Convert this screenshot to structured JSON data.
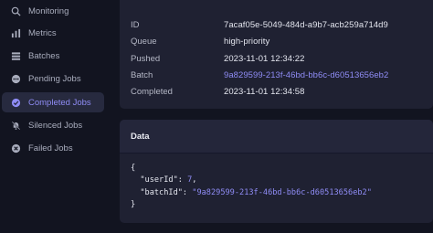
{
  "sidebar": {
    "items": [
      {
        "label": "Monitoring",
        "icon": "search-icon"
      },
      {
        "label": "Metrics",
        "icon": "bar-chart-icon"
      },
      {
        "label": "Batches",
        "icon": "stack-icon"
      },
      {
        "label": "Pending Jobs",
        "icon": "pending-icon"
      },
      {
        "label": "Completed Jobs",
        "icon": "check-circle-icon",
        "active": true
      },
      {
        "label": "Silenced Jobs",
        "icon": "bell-off-icon"
      },
      {
        "label": "Failed Jobs",
        "icon": "x-circle-icon"
      }
    ]
  },
  "details": {
    "id_label": "ID",
    "id_value": "7acaf05e-5049-484d-a9b7-acb259a714d9",
    "queue_label": "Queue",
    "queue_value": "high-priority",
    "pushed_label": "Pushed",
    "pushed_value": "2023-11-01 12:34:22",
    "batch_label": "Batch",
    "batch_value": "9a829599-213f-46bd-bb6c-d60513656eb2",
    "completed_label": "Completed",
    "completed_value": "2023-11-01 12:34:58"
  },
  "data_panel": {
    "title": "Data",
    "open_brace": "{",
    "close_brace": "}",
    "user_id_key": "\"userId\": ",
    "user_id_value": "7",
    "batch_id_key": "\"batchId\": ",
    "batch_id_value": "\"9a829599-213f-46bd-bb6c-d60513656eb2\""
  },
  "colors": {
    "background": "#121420",
    "card": "#1f2132",
    "accent": "#8f8cf5"
  }
}
